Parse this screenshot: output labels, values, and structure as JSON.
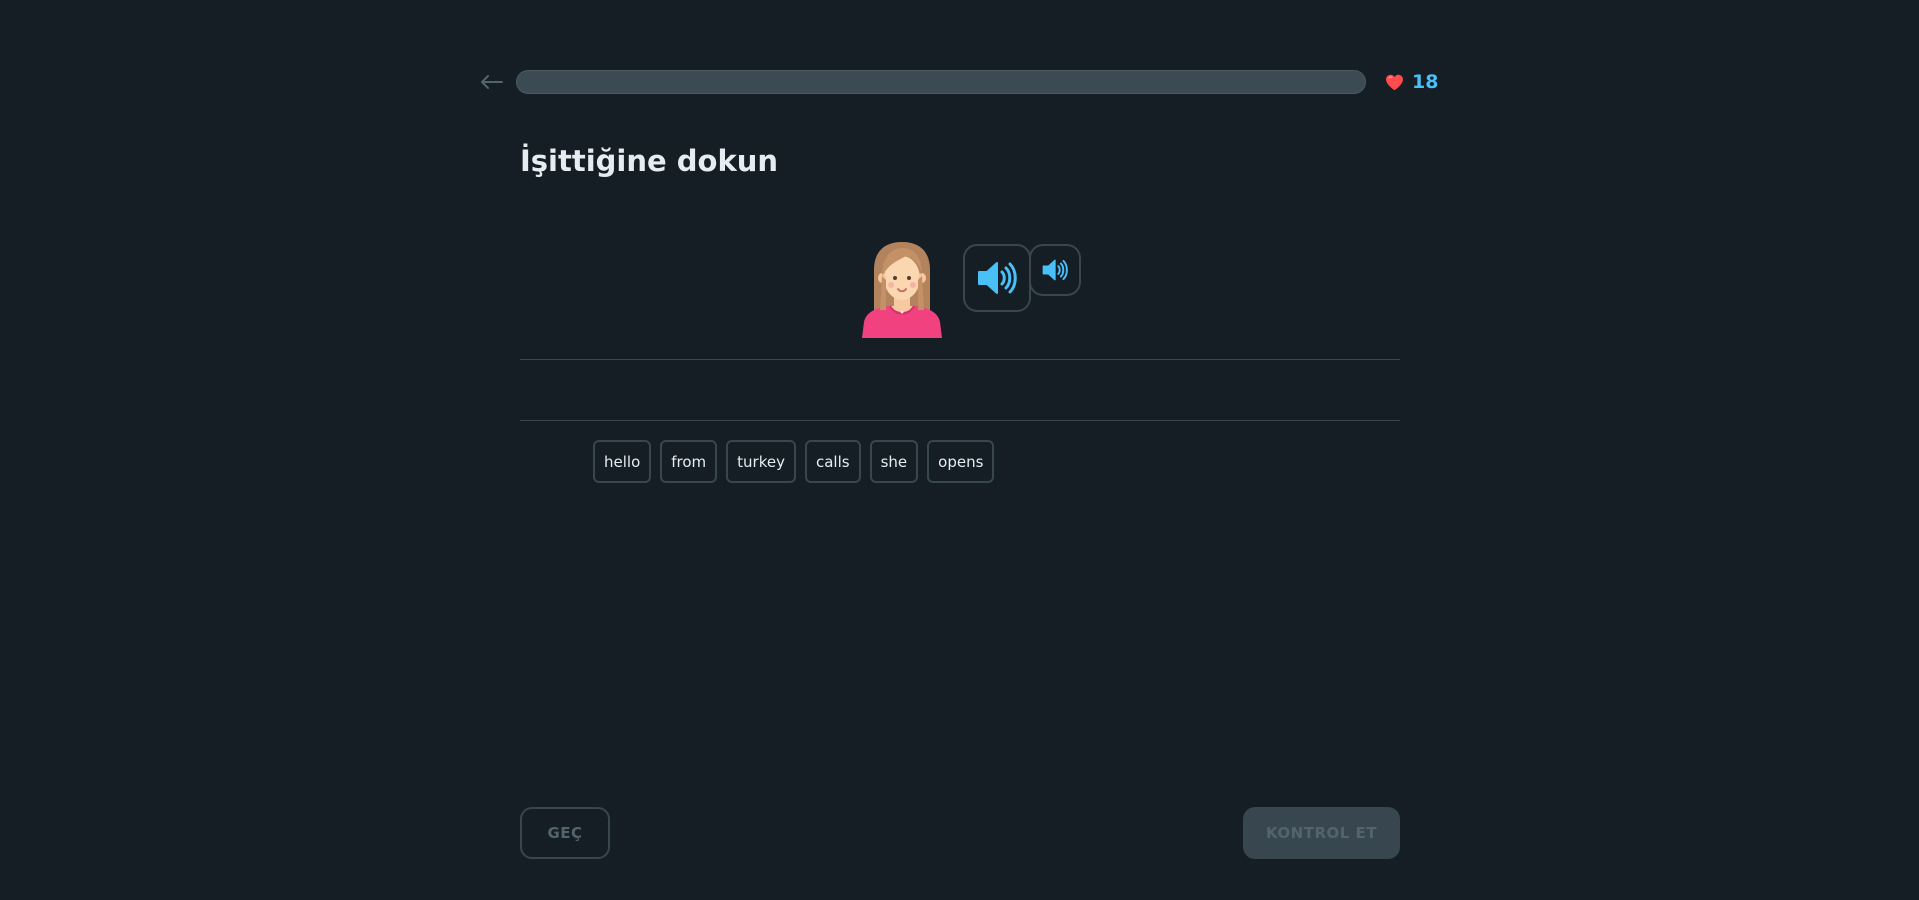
{
  "header": {
    "back_icon": "arrow-left-icon",
    "progress_fraction": 0,
    "hearts_icon": "heart-icon",
    "hearts_count": "18",
    "colors": {
      "heart": "#ff4b4b",
      "hearts_count": "#49c0f8",
      "progress_track": "#3b4a53"
    }
  },
  "exercise": {
    "title": "İşittiğine dokun",
    "character": "woman-avatar",
    "audio_normal_icon": "speaker-icon",
    "audio_slow_icon": "speaker-slow-icon",
    "word_bank": [
      "hello",
      "from",
      "turkey",
      "calls",
      "she",
      "opens"
    ]
  },
  "footer": {
    "skip_label": "GEÇ",
    "check_label": "KONTROL ET"
  },
  "colors": {
    "background": "#151e25",
    "border": "#37464f",
    "accent_blue": "#49c0f8"
  }
}
